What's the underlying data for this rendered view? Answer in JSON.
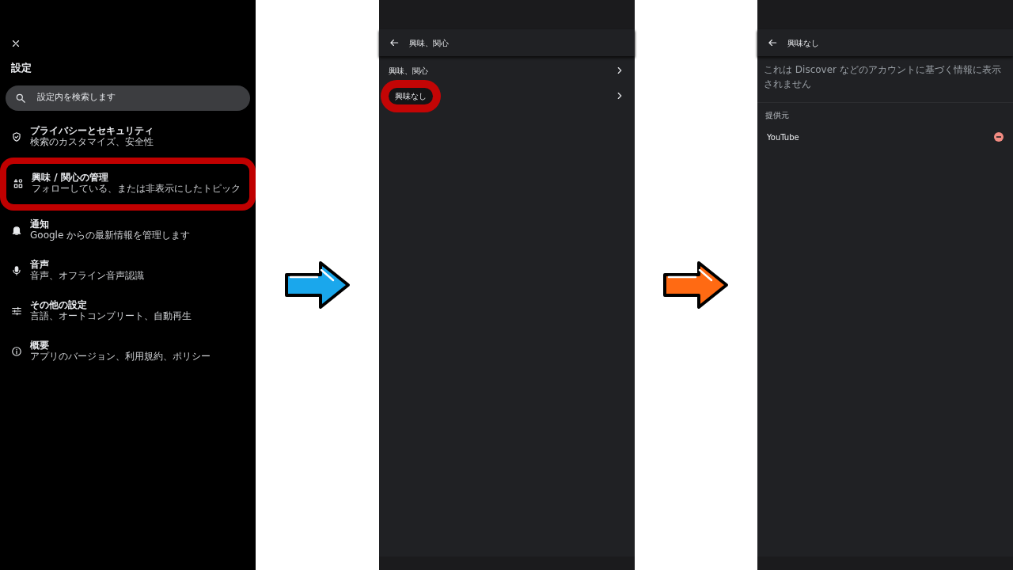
{
  "panels": [
    {
      "kind": "settings",
      "title": "設定",
      "search": {
        "placeholder": "設定内を検索します"
      },
      "items": [
        {
          "title": "プライバシーとセキュリティ",
          "subtitle": "検索のカスタマイズ、安全性",
          "highlighted": false
        },
        {
          "title": "興味 / 関心の管理",
          "subtitle": "フォローしている、または非表示にしたトピック",
          "highlighted": true
        },
        {
          "title": "通知",
          "subtitle": "Google からの最新情報を管理します",
          "highlighted": false
        },
        {
          "title": "音声",
          "subtitle": "音声、オフライン音声認識",
          "highlighted": false
        },
        {
          "title": "その他の設定",
          "subtitle": "言語、オートコンプリート、自動再生",
          "highlighted": false
        },
        {
          "title": "概要",
          "subtitle": "アプリのバージョン、利用規約、ポリシー",
          "highlighted": false
        }
      ]
    },
    {
      "kind": "list",
      "title": "興味、関心",
      "items": [
        {
          "label": "興味、関心",
          "highlighted": false
        },
        {
          "label": "興味なし",
          "highlighted": true
        }
      ]
    },
    {
      "kind": "detail",
      "title": "興味なし",
      "description": "これは Discover などのアカウントに基づく情報に表示されません",
      "section": "提供元",
      "items": [
        {
          "label": "YouTube"
        }
      ]
    }
  ],
  "arrows": [
    {
      "color": "#1aa7ec"
    },
    {
      "color": "#ff6a13"
    }
  ]
}
